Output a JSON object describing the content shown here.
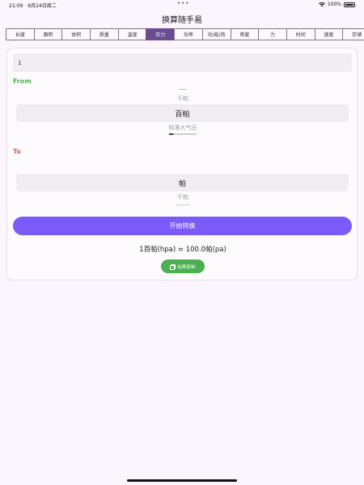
{
  "status_bar": {
    "time": "21:09",
    "date": "6月24日周二",
    "battery": "100%"
  },
  "app": {
    "title": "换算随手易"
  },
  "tabs": [
    {
      "label": "长度"
    },
    {
      "label": "面积"
    },
    {
      "label": "体积"
    },
    {
      "label": "质量"
    },
    {
      "label": "温度"
    },
    {
      "label": "压力",
      "active": true
    },
    {
      "label": "功率"
    },
    {
      "label": "功/能/热"
    },
    {
      "label": "密度"
    },
    {
      "label": "力"
    },
    {
      "label": "时间"
    },
    {
      "label": "速度"
    },
    {
      "label": "存储"
    }
  ],
  "input": {
    "value": "1"
  },
  "from": {
    "label": "From",
    "above": "千帕",
    "selected": "百帕",
    "below": "标准大气压"
  },
  "to": {
    "label": "To",
    "selected": "帕",
    "below": "千帕"
  },
  "convert_button": {
    "label": "开始转换"
  },
  "result": {
    "text": "1百帕(hpa) = 100.0帕(pa)"
  },
  "copy_button": {
    "label": "结果复制"
  },
  "colors": {
    "accent": "#7a5af8",
    "active_tab": "#6a4c93",
    "from": "#4caf50",
    "to": "#e65a4f",
    "copy": "#4caf50"
  }
}
